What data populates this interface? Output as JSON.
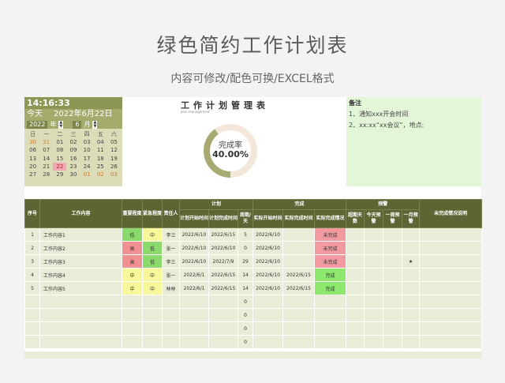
{
  "header": {
    "title": "绿色简约工作计划表",
    "subtitle": "内容可修改/配色可换/EXCEL格式"
  },
  "calendar": {
    "time": "14:16:33",
    "today_label": "今天",
    "today_date": "2022年6月22日",
    "year": "2022",
    "year_label": "年",
    "month": "6",
    "month_label": "月",
    "weekdays": [
      "日",
      "一",
      "二",
      "三",
      "四",
      "五",
      "六"
    ],
    "days": [
      [
        "30",
        "31",
        "01",
        "02",
        "03",
        "04",
        "05"
      ],
      [
        "06",
        "07",
        "08",
        "09",
        "10",
        "11",
        "12"
      ],
      [
        "13",
        "14",
        "15",
        "16",
        "17",
        "18",
        "19"
      ],
      [
        "20",
        "21",
        "22",
        "23",
        "24",
        "25",
        "26"
      ],
      [
        "27",
        "28",
        "29",
        "30",
        "01",
        "02",
        "03"
      ]
    ]
  },
  "plan": {
    "title": "工作计划管理表",
    "subtitle": "plan management",
    "completion_label": "完成率",
    "completion_value": "40.00%",
    "completion_fraction": 0.4
  },
  "notes": {
    "heading": "备注",
    "items": [
      "1、通知xxx开会时间",
      "2、xx:xx“xx会议”，地点:"
    ]
  },
  "table": {
    "headers": {
      "no": "序号",
      "content": "工作内容",
      "importance": "重要程度",
      "urgency": "紧急程度",
      "owner": "责任人",
      "plan_group": "计划",
      "done_group": "完成",
      "warn_group": "预警",
      "plan_start": "计划开始时间",
      "plan_end": "计划完成时间",
      "cycle": "周期/天",
      "actual_start": "实际开始时间",
      "actual_end": "实际完成时间",
      "actual_status": "实际完成情况",
      "overdue": "超期天数",
      "today_warn": "今天预警",
      "week_warn": "一周预警",
      "month_warn": "一月预警",
      "unfinished_note": "未完成情况说明"
    },
    "rows": [
      {
        "no": "1",
        "content": "工作内容1",
        "importance": "低",
        "urgency": "中",
        "owner": "李三",
        "plan_start": "2022/6/10",
        "plan_end": "2022/6/15",
        "cycle": "5",
        "actual_start": "2022/6/10",
        "actual_end": "",
        "status": "未完成",
        "month_warn": ""
      },
      {
        "no": "2",
        "content": "工作内容2",
        "importance": "高",
        "urgency": "低",
        "owner": "张一",
        "plan_start": "2022/6/10",
        "plan_end": "2022/6/10",
        "cycle": "0",
        "actual_start": "2022/6/10",
        "actual_end": "",
        "status": "未完成",
        "month_warn": ""
      },
      {
        "no": "3",
        "content": "工作内容3",
        "importance": "高",
        "urgency": "低",
        "owner": "李三",
        "plan_start": "2022/6/10",
        "plan_end": "2022/7/9",
        "cycle": "29",
        "actual_start": "2022/6/10",
        "actual_end": "",
        "status": "未完成",
        "month_warn": "★"
      },
      {
        "no": "4",
        "content": "工作内容4",
        "importance": "中",
        "urgency": "中",
        "owner": "张一",
        "plan_start": "2022/6/1",
        "plan_end": "2022/6/15",
        "cycle": "14",
        "actual_start": "2022/6/10",
        "actual_end": "2022/6/15",
        "status": "完成",
        "month_warn": ""
      },
      {
        "no": "5",
        "content": "工作内容5",
        "importance": "中",
        "urgency": "中",
        "owner": "林林",
        "plan_start": "2022/6/1",
        "plan_end": "2022/6/15",
        "cycle": "14",
        "actual_start": "2022/6/10",
        "actual_end": "2022/6/15",
        "status": "完成",
        "month_warn": ""
      }
    ],
    "empty_cycle": "0"
  }
}
